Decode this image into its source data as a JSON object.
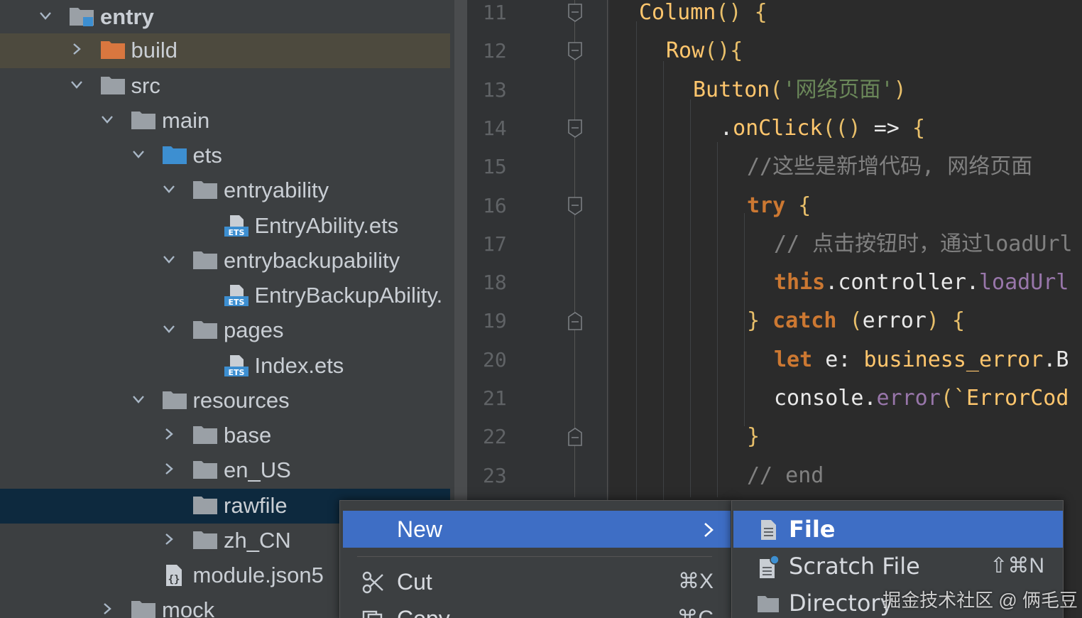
{
  "project_tree": {
    "items": [
      {
        "label": "entry",
        "icon": "module-folder-icon",
        "expanded": true
      },
      {
        "label": "build",
        "icon": "excluded-folder-icon",
        "expanded": false
      },
      {
        "label": "src",
        "icon": "folder-icon",
        "expanded": true
      },
      {
        "label": "main",
        "icon": "folder-icon",
        "expanded": true
      },
      {
        "label": "ets",
        "icon": "source-folder-icon",
        "expanded": true
      },
      {
        "label": "entryability",
        "icon": "folder-icon",
        "expanded": true
      },
      {
        "label": "EntryAbility.ets",
        "icon": "ets-file-icon"
      },
      {
        "label": "entrybackupability",
        "icon": "folder-icon",
        "expanded": true
      },
      {
        "label": "EntryBackupAbility.",
        "icon": "ets-file-icon"
      },
      {
        "label": "pages",
        "icon": "folder-icon",
        "expanded": true
      },
      {
        "label": "Index.ets",
        "icon": "ets-file-icon"
      },
      {
        "label": "resources",
        "icon": "folder-icon",
        "expanded": true
      },
      {
        "label": "base",
        "icon": "folder-icon",
        "expanded": false
      },
      {
        "label": "en_US",
        "icon": "folder-icon",
        "expanded": false
      },
      {
        "label": "rawfile",
        "icon": "folder-icon",
        "selected": true
      },
      {
        "label": "zh_CN",
        "icon": "folder-icon",
        "expanded": false
      },
      {
        "label": "module.json5",
        "icon": "json5-file-icon"
      },
      {
        "label": "mock",
        "icon": "folder-icon",
        "expanded": false
      }
    ]
  },
  "editor": {
    "line_numbers": [
      "11",
      "12",
      "13",
      "14",
      "15",
      "16",
      "17",
      "18",
      "19",
      "20",
      "21",
      "22",
      "23"
    ],
    "lines": [
      [
        {
          "t": "Column",
          "c": "fn"
        },
        {
          "t": "() ",
          "c": "br"
        },
        {
          "t": "{",
          "c": "br"
        }
      ],
      [
        {
          "t": "Row",
          "c": "fn"
        },
        {
          "t": "(){",
          "c": "br"
        }
      ],
      [
        {
          "t": "Button",
          "c": "fn"
        },
        {
          "t": "(",
          "c": "br"
        },
        {
          "t": "'网络页面'",
          "c": "str"
        },
        {
          "t": ")",
          "c": "br"
        }
      ],
      [
        {
          "t": ".",
          "c": "pl"
        },
        {
          "t": "onClick",
          "c": "fn"
        },
        {
          "t": "(() ",
          "c": "br"
        },
        {
          "t": "=> ",
          "c": "pl"
        },
        {
          "t": "{",
          "c": "br"
        }
      ],
      [
        {
          "t": "//这些是新增代码, 网络页面",
          "c": "cm"
        }
      ],
      [
        {
          "t": "try ",
          "c": "k"
        },
        {
          "t": "{",
          "c": "br"
        }
      ],
      [
        {
          "t": "// 点击按钮时，通过loadUrl",
          "c": "cm"
        }
      ],
      [
        {
          "t": "this",
          "c": "k"
        },
        {
          "t": ".",
          "c": "pl"
        },
        {
          "t": "controller",
          "c": "pl"
        },
        {
          "t": ".",
          "c": "pl"
        },
        {
          "t": "loadUrl",
          "c": "prop"
        }
      ],
      [
        {
          "t": "} ",
          "c": "br"
        },
        {
          "t": "catch ",
          "c": "k"
        },
        {
          "t": "(",
          "c": "br"
        },
        {
          "t": "error",
          "c": "pl"
        },
        {
          "t": ") ",
          "c": "br"
        },
        {
          "t": "{",
          "c": "br"
        }
      ],
      [
        {
          "t": "let ",
          "c": "k"
        },
        {
          "t": "e",
          "c": "pl"
        },
        {
          "t": ": ",
          "c": "pl"
        },
        {
          "t": "business_error",
          "c": "fn"
        },
        {
          "t": ".B",
          "c": "pl"
        }
      ],
      [
        {
          "t": "console",
          "c": "pl"
        },
        {
          "t": ".",
          "c": "pl"
        },
        {
          "t": "error",
          "c": "prop"
        },
        {
          "t": "(`",
          "c": "br"
        },
        {
          "t": "ErrorCod",
          "c": "fn"
        }
      ],
      [
        {
          "t": "}",
          "c": "br"
        }
      ],
      [
        {
          "t": "// end",
          "c": "cm"
        }
      ]
    ]
  },
  "context_menu": {
    "items": [
      {
        "label": "New",
        "shortcut": "",
        "has_submenu": true,
        "selected": true
      },
      {
        "label": "Cut",
        "shortcut": "⌘X",
        "icon": "scissors-icon"
      },
      {
        "label": "Copy",
        "shortcut": "⌘C",
        "icon": "copy-icon"
      }
    ]
  },
  "submenu": {
    "items": [
      {
        "label": "File",
        "shortcut": "",
        "icon": "file-icon",
        "selected": true
      },
      {
        "label": "Scratch File",
        "shortcut": "⇧⌘N",
        "icon": "scratch-file-icon"
      },
      {
        "label": "Directory",
        "shortcut": "",
        "icon": "folder-icon"
      }
    ]
  },
  "watermark": {
    "text": "掘金技术社区 @ 俩毛豆"
  },
  "colors": {
    "tree_bg": "#3c3f41",
    "editor_bg": "#2b2b2b",
    "menu_selected": "#3e6ec5",
    "tree_selected": "#0d293e",
    "folder_gray": "#9aa0a6",
    "folder_blue": "#3d8fd1",
    "folder_orange": "#d9773f"
  }
}
